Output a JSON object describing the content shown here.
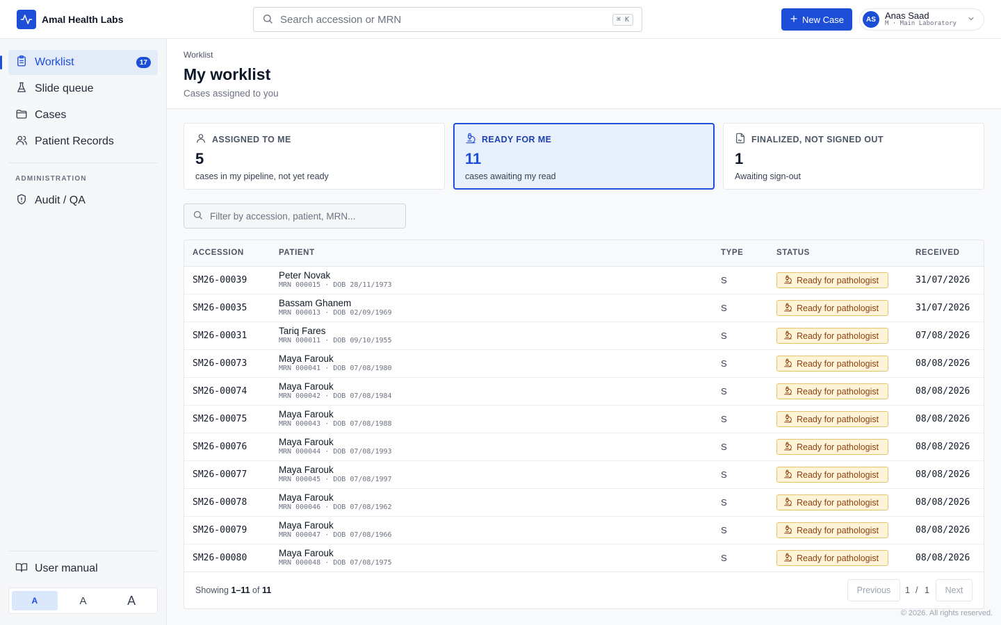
{
  "app": {
    "name": "Amal Health Labs"
  },
  "search": {
    "placeholder": "Search accession or MRN",
    "shortcut": "⌘ K"
  },
  "header": {
    "new_case_label": "New Case"
  },
  "user": {
    "initials": "AS",
    "name": "Anas Saad",
    "subtitle": "M · Main Laboratory"
  },
  "sidebar": {
    "items": [
      {
        "label": "Worklist",
        "badge": "17",
        "icon": "clipboard-icon"
      },
      {
        "label": "Slide queue",
        "icon": "flask-icon"
      },
      {
        "label": "Cases",
        "icon": "folder-icon"
      },
      {
        "label": "Patient Records",
        "icon": "users-icon"
      }
    ],
    "admin_heading": "ADMINISTRATION",
    "admin_items": [
      {
        "label": "Audit / QA",
        "icon": "shield-icon"
      }
    ],
    "manual_label": "User manual",
    "font_sizes": [
      "A",
      "A",
      "A"
    ]
  },
  "page": {
    "breadcrumb": "Worklist",
    "title": "My worklist",
    "subtitle": "Cases assigned to you"
  },
  "stats": [
    {
      "label": "ASSIGNED TO ME",
      "value": "5",
      "desc": "cases in my pipeline, not yet ready",
      "icon": "user-icon"
    },
    {
      "label": "READY FOR ME",
      "value": "11",
      "desc": "cases awaiting my read",
      "icon": "microscope-icon"
    },
    {
      "label": "FINALIZED, NOT SIGNED OUT",
      "value": "1",
      "desc": "Awaiting sign-out",
      "icon": "file-signature-icon"
    }
  ],
  "filter": {
    "placeholder": "Filter by accession, patient, MRN..."
  },
  "table": {
    "columns": [
      "ACCESSION",
      "PATIENT",
      "TYPE",
      "STATUS",
      "RECEIVED"
    ],
    "rows": [
      {
        "accession": "SM26-00039",
        "patient": "Peter Novak",
        "meta": "MRN 000015 · DOB 28/11/1973",
        "type": "S",
        "status": "Ready for pathologist",
        "received": "31/07/2026"
      },
      {
        "accession": "SM26-00035",
        "patient": "Bassam Ghanem",
        "meta": "MRN 000013 · DOB 02/09/1969",
        "type": "S",
        "status": "Ready for pathologist",
        "received": "31/07/2026"
      },
      {
        "accession": "SM26-00031",
        "patient": "Tariq Fares",
        "meta": "MRN 000011 · DOB 09/10/1955",
        "type": "S",
        "status": "Ready for pathologist",
        "received": "07/08/2026"
      },
      {
        "accession": "SM26-00073",
        "patient": "Maya Farouk",
        "meta": "MRN 000041 · DOB 07/08/1980",
        "type": "S",
        "status": "Ready for pathologist",
        "received": "08/08/2026"
      },
      {
        "accession": "SM26-00074",
        "patient": "Maya Farouk",
        "meta": "MRN 000042 · DOB 07/08/1984",
        "type": "S",
        "status": "Ready for pathologist",
        "received": "08/08/2026"
      },
      {
        "accession": "SM26-00075",
        "patient": "Maya Farouk",
        "meta": "MRN 000043 · DOB 07/08/1988",
        "type": "S",
        "status": "Ready for pathologist",
        "received": "08/08/2026"
      },
      {
        "accession": "SM26-00076",
        "patient": "Maya Farouk",
        "meta": "MRN 000044 · DOB 07/08/1993",
        "type": "S",
        "status": "Ready for pathologist",
        "received": "08/08/2026"
      },
      {
        "accession": "SM26-00077",
        "patient": "Maya Farouk",
        "meta": "MRN 000045 · DOB 07/08/1997",
        "type": "S",
        "status": "Ready for pathologist",
        "received": "08/08/2026"
      },
      {
        "accession": "SM26-00078",
        "patient": "Maya Farouk",
        "meta": "MRN 000046 · DOB 07/08/1962",
        "type": "S",
        "status": "Ready for pathologist",
        "received": "08/08/2026"
      },
      {
        "accession": "SM26-00079",
        "patient": "Maya Farouk",
        "meta": "MRN 000047 · DOB 07/08/1966",
        "type": "S",
        "status": "Ready for pathologist",
        "received": "08/08/2026"
      },
      {
        "accession": "SM26-00080",
        "patient": "Maya Farouk",
        "meta": "MRN 000048 · DOB 07/08/1975",
        "type": "S",
        "status": "Ready for pathologist",
        "received": "08/08/2026"
      }
    ]
  },
  "pagination": {
    "showing_prefix": "Showing",
    "range": "1–11",
    "of_word": "of",
    "total": "11",
    "previous": "Previous",
    "current": "1",
    "separator": "/",
    "pages": "1",
    "next": "Next"
  },
  "footer": {
    "copyright": "© 2026. All rights reserved."
  },
  "colors": {
    "accent": "#1d4ed8",
    "status_bg": "#fdf4d8",
    "status_border": "#e9c36b",
    "status_text": "#92400e"
  }
}
